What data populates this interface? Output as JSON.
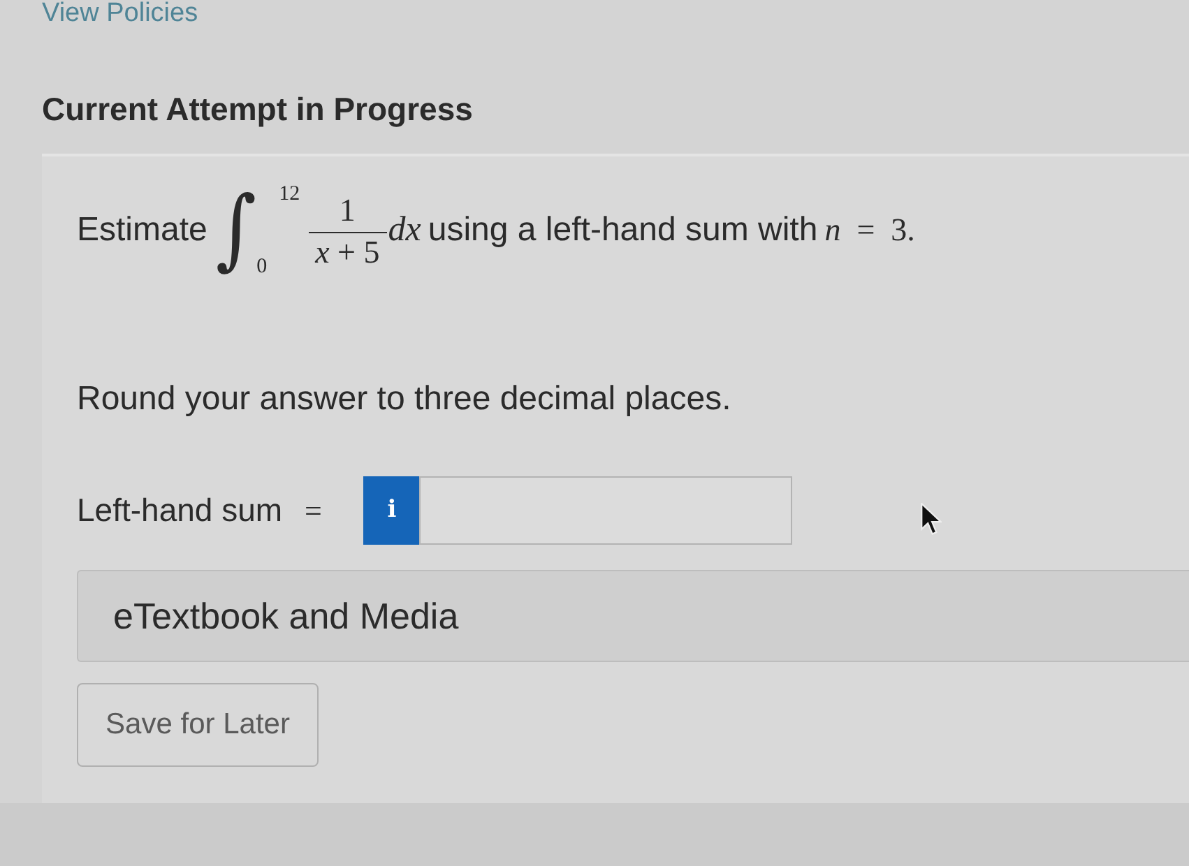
{
  "header": {
    "link": "View Policies",
    "title": "Current Attempt in Progress"
  },
  "question": {
    "lead": "Estimate",
    "integral": {
      "sign": "∫",
      "lower": "0",
      "upper": "12",
      "numerator": "1",
      "denominator": "*x* + 5",
      "differential": "dx"
    },
    "trail": "using a left-hand sum with",
    "condition": "*n* = 3."
  },
  "instruction": "Round your answer to three decimal places.",
  "answer": {
    "label": "Left-hand sum",
    "relation": "=",
    "info_button": "i"
  },
  "resources": {
    "label": "eTextbook and Media"
  },
  "buttons": [
    "Save for Later"
  ]
}
